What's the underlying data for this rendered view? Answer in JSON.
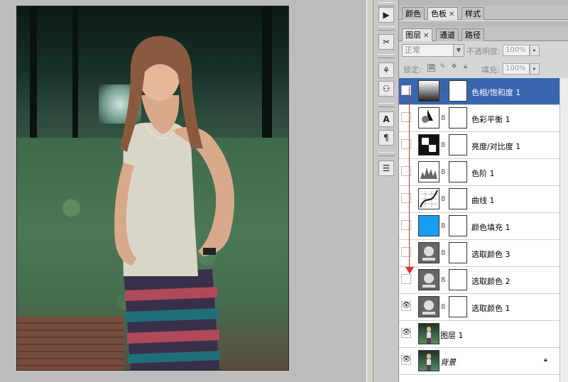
{
  "panel_top": {
    "tabs": [
      {
        "label": "颜色",
        "active": false
      },
      {
        "label": "色板",
        "active": true
      },
      {
        "label": "样式",
        "active": false
      }
    ]
  },
  "layers_panel": {
    "tabs": [
      {
        "label": "图层",
        "active": true
      },
      {
        "label": "通道",
        "active": false
      },
      {
        "label": "路径",
        "active": false
      }
    ],
    "blend_mode": "正常",
    "opacity_label": "不透明度:",
    "opacity_value": "100%",
    "lock_label": "锁定:",
    "fill_label": "填充:",
    "fill_value": "100%",
    "layers": [
      {
        "name": "色相/饱和度 1",
        "type": "adjustment",
        "icon": "hue-saturation-icon",
        "visible": false,
        "selected": true
      },
      {
        "name": "色彩平衡 1",
        "type": "adjustment",
        "icon": "color-balance-icon",
        "visible": false,
        "selected": false
      },
      {
        "name": "亮度/对比度 1",
        "type": "adjustment",
        "icon": "brightness-contrast-icon",
        "visible": false,
        "selected": false
      },
      {
        "name": "色阶 1",
        "type": "adjustment",
        "icon": "levels-icon",
        "visible": false,
        "selected": false
      },
      {
        "name": "曲线 1",
        "type": "adjustment",
        "icon": "curves-icon",
        "visible": false,
        "selected": false
      },
      {
        "name": "颜色填充 1",
        "type": "fill",
        "icon": "solid-color-icon",
        "fill_color": "#1a9cf0",
        "visible": false,
        "selected": false
      },
      {
        "name": "选取颜色 3",
        "type": "adjustment",
        "icon": "selective-color-icon",
        "visible": false,
        "selected": false
      },
      {
        "name": "选取颜色 2",
        "type": "adjustment",
        "icon": "selective-color-icon",
        "visible": false,
        "selected": false
      },
      {
        "name": "选取颜色 1",
        "type": "adjustment",
        "icon": "selective-color-icon",
        "visible": true,
        "selected": false
      },
      {
        "name": "图层 1",
        "type": "pixel",
        "icon": "photo-thumbnail",
        "visible": true,
        "selected": false
      },
      {
        "name": "背景",
        "type": "background",
        "icon": "photo-thumbnail",
        "visible": true,
        "selected": false,
        "locked": true
      }
    ]
  },
  "toolstrip": {
    "icons": [
      "play-icon",
      "tools-icon",
      "brush-presets-icon",
      "stamp-icon",
      "character-icon",
      "paragraph-icon",
      "notes-icon"
    ]
  },
  "colors": {
    "selection": "#3a66b0",
    "arrow": "#e03030"
  }
}
